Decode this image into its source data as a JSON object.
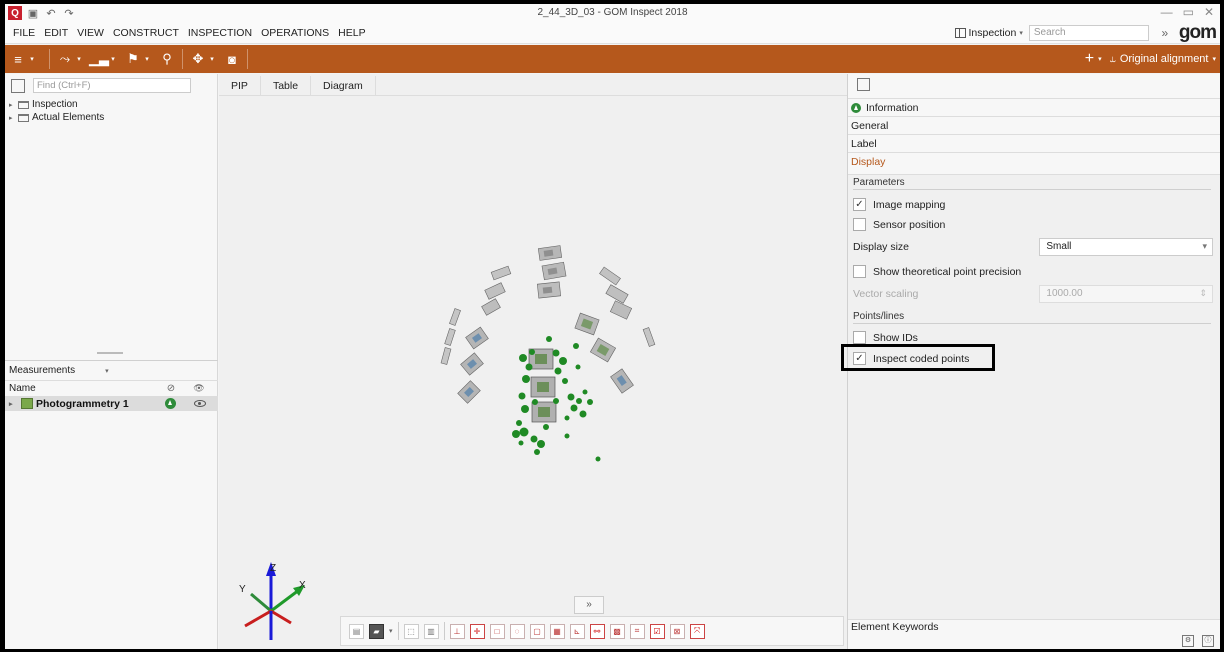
{
  "window": {
    "title": "2_44_3D_03 - GOM Inspect 2018",
    "controls": [
      "—",
      "▭",
      "✕"
    ]
  },
  "menu": {
    "items": [
      "FILE",
      "EDIT",
      "VIEW",
      "CONSTRUCT",
      "INSPECTION",
      "OPERATIONS",
      "HELP"
    ],
    "workspace_label": "Inspection",
    "search_placeholder": "Search",
    "logo": "gom"
  },
  "toolbar": {
    "alignment_label": "Original alignment"
  },
  "left_panel": {
    "find_placeholder": "Find (Ctrl+F)",
    "tree": [
      {
        "label": "Inspection"
      },
      {
        "label": "Actual Elements"
      }
    ],
    "measurements_label": "Measurements",
    "column_name": "Name",
    "row_label": "Photogrammetry 1"
  },
  "center": {
    "tabs": [
      "PIP",
      "Table",
      "Diagram"
    ],
    "axes": {
      "x": "X",
      "y": "Y",
      "z": "Z"
    }
  },
  "right_panel": {
    "sections": {
      "information": "Information",
      "general": "General",
      "label": "Label",
      "display": "Display"
    },
    "parameters_title": "Parameters",
    "image_mapping": {
      "label": "Image mapping",
      "checked": true
    },
    "sensor_position": {
      "label": "Sensor position",
      "checked": false
    },
    "display_size": {
      "label": "Display size",
      "value": "Small"
    },
    "theoretical_precision": {
      "label": "Show theoretical point precision",
      "checked": false
    },
    "vector_scaling": {
      "label": "Vector scaling",
      "value": "1000.00"
    },
    "points_lines_title": "Points/lines",
    "show_ids": {
      "label": "Show IDs",
      "checked": false
    },
    "inspect_coded": {
      "label": "Inspect coded points",
      "checked": true
    },
    "element_keywords": "Element Keywords"
  },
  "colors": {
    "accent": "#b5581c",
    "status_green": "#2e8b3a",
    "point_green": "#1f8a24"
  }
}
